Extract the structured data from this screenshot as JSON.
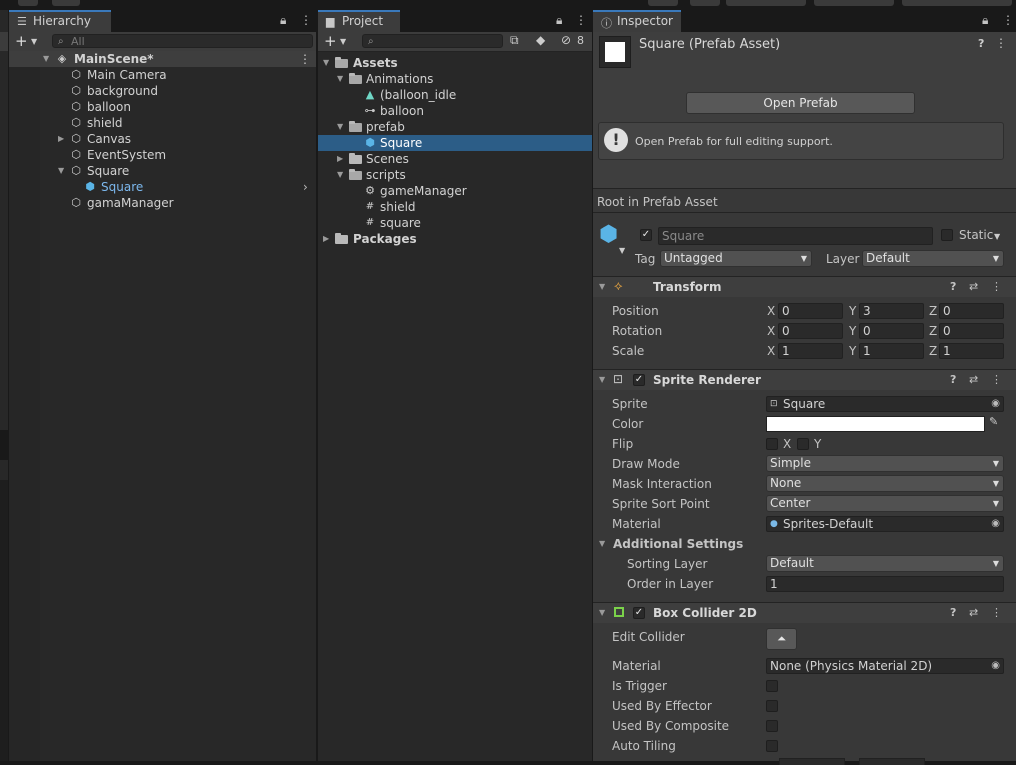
{
  "hierarchy": {
    "tab_label": "Hierarchy",
    "search_placeholder": "All",
    "scene_name": "MainScene*",
    "items": [
      {
        "label": "Main Camera"
      },
      {
        "label": "background"
      },
      {
        "label": "balloon"
      },
      {
        "label": "shield"
      },
      {
        "label": "Canvas"
      },
      {
        "label": "EventSystem"
      },
      {
        "label": "Square"
      },
      {
        "label": "Square"
      },
      {
        "label": "gamaManager"
      }
    ]
  },
  "project": {
    "tab_label": "Project",
    "hidden_count": "8",
    "items": [
      {
        "label": "Assets"
      },
      {
        "label": "Animations"
      },
      {
        "label": "(balloon_idle"
      },
      {
        "label": "balloon"
      },
      {
        "label": "prefab"
      },
      {
        "label": "Square"
      },
      {
        "label": "Scenes"
      },
      {
        "label": "scripts"
      },
      {
        "label": "gameManager"
      },
      {
        "label": "shield"
      },
      {
        "label": "square"
      },
      {
        "label": "Packages"
      }
    ]
  },
  "inspector": {
    "tab_label": "Inspector",
    "asset_title": "Square (Prefab Asset)",
    "open_prefab_label": "Open Prefab",
    "help_text": "Open Prefab for full editing support.",
    "root_label": "Root in Prefab Asset",
    "object_name": "Square",
    "static_label": "Static",
    "tag_label": "Tag",
    "tag_value": "Untagged",
    "layer_label": "Layer",
    "layer_value": "Default",
    "transform": {
      "title": "Transform",
      "position_label": "Position",
      "rotation_label": "Rotation",
      "scale_label": "Scale",
      "position": {
        "x": "0",
        "y": "3",
        "z": "0"
      },
      "rotation": {
        "x": "0",
        "y": "0",
        "z": "0"
      },
      "scale": {
        "x": "1",
        "y": "1",
        "z": "1"
      },
      "axis_x": "X",
      "axis_y": "Y",
      "axis_z": "Z"
    },
    "sprite_renderer": {
      "title": "Sprite Renderer",
      "sprite_label": "Sprite",
      "sprite_value": "Square",
      "color_label": "Color",
      "color_value": "#ffffff",
      "flip_label": "Flip",
      "flip_x": "X",
      "flip_y": "Y",
      "draw_mode_label": "Draw Mode",
      "draw_mode_value": "Simple",
      "mask_label": "Mask Interaction",
      "mask_value": "None",
      "sort_point_label": "Sprite Sort Point",
      "sort_point_value": "Center",
      "material_label": "Material",
      "material_value": "Sprites-Default",
      "additional_label": "Additional Settings",
      "sorting_layer_label": "Sorting Layer",
      "sorting_layer_value": "Default",
      "order_label": "Order in Layer",
      "order_value": "1"
    },
    "box_collider": {
      "title": "Box Collider 2D",
      "edit_label": "Edit Collider",
      "material_label": "Material",
      "material_value": "None (Physics Material 2D)",
      "is_trigger_label": "Is Trigger",
      "used_by_effector_label": "Used By Effector",
      "used_by_composite_label": "Used By Composite",
      "auto_tiling_label": "Auto Tiling"
    }
  },
  "colors": {
    "accent": "#3a79bb",
    "selection": "#2c5d87",
    "panel_bg": "#282828",
    "inspector_bg": "#383838"
  }
}
